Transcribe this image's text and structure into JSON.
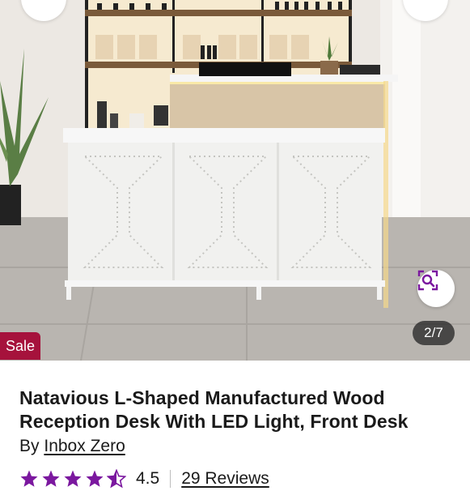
{
  "gallery": {
    "counter": "2/7",
    "sale_badge": "Sale",
    "visual_search_icon": "visual-search-icon"
  },
  "product": {
    "title": "Natavious L-Shaped Manufactured Wood Reception Desk With LED Light, Front Desk",
    "by_prefix": "By",
    "brand": "Inbox Zero",
    "rating": "4.5",
    "rating_fraction": 0.9,
    "reviews_label": "29 Reviews"
  },
  "colors": {
    "accent": "#7b189f",
    "sale": "#a6123c",
    "star": "#7b189f"
  }
}
